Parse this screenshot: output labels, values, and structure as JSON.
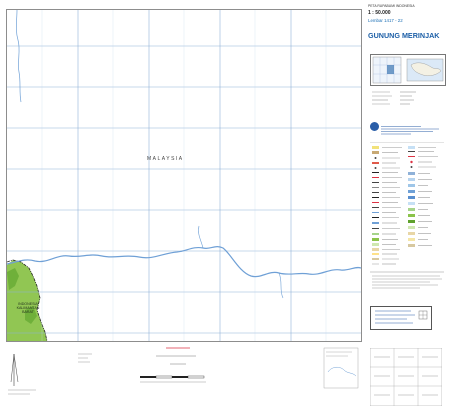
{
  "map": {
    "series_label": "PETA RUPABUMI INDONESIA",
    "scale": "1 : 50.000",
    "sheet_number": "Lembar 1417 - 22",
    "sheet_name": "GUNUNG MERINJAK",
    "country_label": "MALAYSIA",
    "indonesia_label": "INDONESIA",
    "province_label": "KALIMANTAN BARAT",
    "colors": {
      "grid": "#8fb1d8",
      "river": "#6fa0d6",
      "vegetation": "#8bc34a",
      "vegetation_dark": "#5fa12d",
      "boundary": "#222222",
      "title_blue": "#1c5fa7",
      "logo": "#2a5ea8"
    }
  },
  "legend": {
    "icon": "legend-symbols"
  }
}
